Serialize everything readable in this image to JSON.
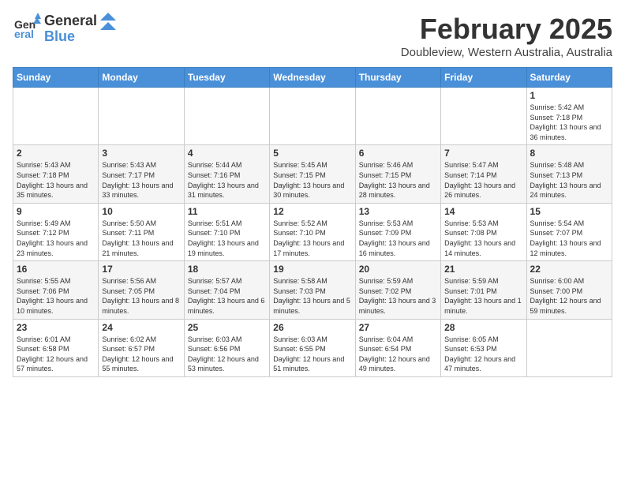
{
  "header": {
    "logo_general": "General",
    "logo_blue": "Blue",
    "month_title": "February 2025",
    "location": "Doubleview, Western Australia, Australia"
  },
  "weekdays": [
    "Sunday",
    "Monday",
    "Tuesday",
    "Wednesday",
    "Thursday",
    "Friday",
    "Saturday"
  ],
  "weeks": [
    [
      {
        "day": "",
        "info": ""
      },
      {
        "day": "",
        "info": ""
      },
      {
        "day": "",
        "info": ""
      },
      {
        "day": "",
        "info": ""
      },
      {
        "day": "",
        "info": ""
      },
      {
        "day": "",
        "info": ""
      },
      {
        "day": "1",
        "info": "Sunrise: 5:42 AM\nSunset: 7:18 PM\nDaylight: 13 hours and 36 minutes."
      }
    ],
    [
      {
        "day": "2",
        "info": "Sunrise: 5:43 AM\nSunset: 7:18 PM\nDaylight: 13 hours and 35 minutes."
      },
      {
        "day": "3",
        "info": "Sunrise: 5:43 AM\nSunset: 7:17 PM\nDaylight: 13 hours and 33 minutes."
      },
      {
        "day": "4",
        "info": "Sunrise: 5:44 AM\nSunset: 7:16 PM\nDaylight: 13 hours and 31 minutes."
      },
      {
        "day": "5",
        "info": "Sunrise: 5:45 AM\nSunset: 7:15 PM\nDaylight: 13 hours and 30 minutes."
      },
      {
        "day": "6",
        "info": "Sunrise: 5:46 AM\nSunset: 7:15 PM\nDaylight: 13 hours and 28 minutes."
      },
      {
        "day": "7",
        "info": "Sunrise: 5:47 AM\nSunset: 7:14 PM\nDaylight: 13 hours and 26 minutes."
      },
      {
        "day": "8",
        "info": "Sunrise: 5:48 AM\nSunset: 7:13 PM\nDaylight: 13 hours and 24 minutes."
      }
    ],
    [
      {
        "day": "9",
        "info": "Sunrise: 5:49 AM\nSunset: 7:12 PM\nDaylight: 13 hours and 23 minutes."
      },
      {
        "day": "10",
        "info": "Sunrise: 5:50 AM\nSunset: 7:11 PM\nDaylight: 13 hours and 21 minutes."
      },
      {
        "day": "11",
        "info": "Sunrise: 5:51 AM\nSunset: 7:10 PM\nDaylight: 13 hours and 19 minutes."
      },
      {
        "day": "12",
        "info": "Sunrise: 5:52 AM\nSunset: 7:10 PM\nDaylight: 13 hours and 17 minutes."
      },
      {
        "day": "13",
        "info": "Sunrise: 5:53 AM\nSunset: 7:09 PM\nDaylight: 13 hours and 16 minutes."
      },
      {
        "day": "14",
        "info": "Sunrise: 5:53 AM\nSunset: 7:08 PM\nDaylight: 13 hours and 14 minutes."
      },
      {
        "day": "15",
        "info": "Sunrise: 5:54 AM\nSunset: 7:07 PM\nDaylight: 13 hours and 12 minutes."
      }
    ],
    [
      {
        "day": "16",
        "info": "Sunrise: 5:55 AM\nSunset: 7:06 PM\nDaylight: 13 hours and 10 minutes."
      },
      {
        "day": "17",
        "info": "Sunrise: 5:56 AM\nSunset: 7:05 PM\nDaylight: 13 hours and 8 minutes."
      },
      {
        "day": "18",
        "info": "Sunrise: 5:57 AM\nSunset: 7:04 PM\nDaylight: 13 hours and 6 minutes."
      },
      {
        "day": "19",
        "info": "Sunrise: 5:58 AM\nSunset: 7:03 PM\nDaylight: 13 hours and 5 minutes."
      },
      {
        "day": "20",
        "info": "Sunrise: 5:59 AM\nSunset: 7:02 PM\nDaylight: 13 hours and 3 minutes."
      },
      {
        "day": "21",
        "info": "Sunrise: 5:59 AM\nSunset: 7:01 PM\nDaylight: 13 hours and 1 minute."
      },
      {
        "day": "22",
        "info": "Sunrise: 6:00 AM\nSunset: 7:00 PM\nDaylight: 12 hours and 59 minutes."
      }
    ],
    [
      {
        "day": "23",
        "info": "Sunrise: 6:01 AM\nSunset: 6:58 PM\nDaylight: 12 hours and 57 minutes."
      },
      {
        "day": "24",
        "info": "Sunrise: 6:02 AM\nSunset: 6:57 PM\nDaylight: 12 hours and 55 minutes."
      },
      {
        "day": "25",
        "info": "Sunrise: 6:03 AM\nSunset: 6:56 PM\nDaylight: 12 hours and 53 minutes."
      },
      {
        "day": "26",
        "info": "Sunrise: 6:03 AM\nSunset: 6:55 PM\nDaylight: 12 hours and 51 minutes."
      },
      {
        "day": "27",
        "info": "Sunrise: 6:04 AM\nSunset: 6:54 PM\nDaylight: 12 hours and 49 minutes."
      },
      {
        "day": "28",
        "info": "Sunrise: 6:05 AM\nSunset: 6:53 PM\nDaylight: 12 hours and 47 minutes."
      },
      {
        "day": "",
        "info": ""
      }
    ]
  ]
}
